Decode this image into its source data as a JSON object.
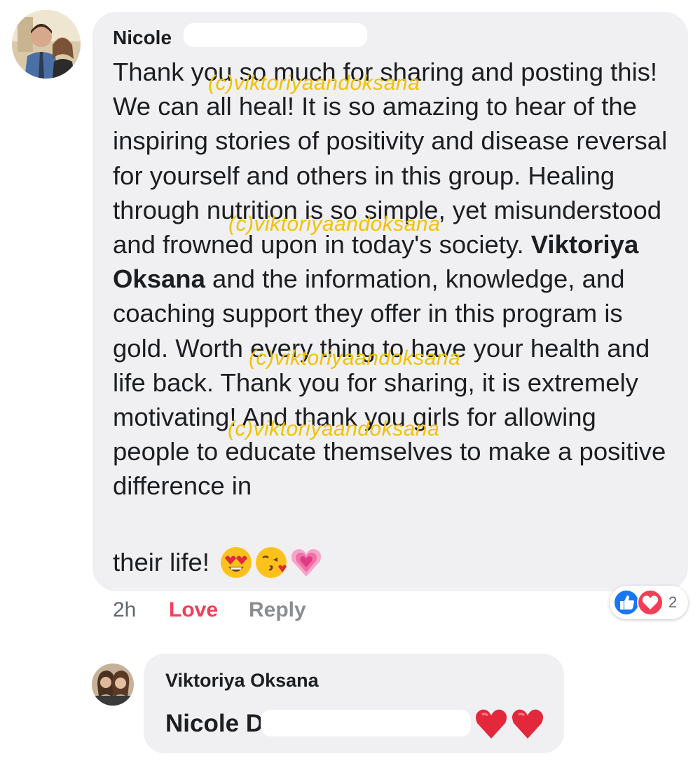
{
  "comment": {
    "author": "Nicole",
    "text_before_mention": "Thank you so much for sharing and posting this! We can all heal! It is so amazing to hear of the inspiring stories of positivity and disease reversal for yourself and others in this group. Healing through nutrition is so simple, yet misunderstood and frowned upon in today's society. ",
    "mention": "Viktoriya Oksana",
    "text_after_mention": " and the information, knowledge, and coaching support they offer in this program is gold. Worth every thing to have your health and life back. Thank you for sharing, it is extremely motivating! And thank you girls for allowing people to educate themselves to make a positive difference in",
    "last_line": "their life!",
    "emojis": [
      "heart-eyes-emoji",
      "kissing-heart-emoji",
      "growing-heart-emoji"
    ],
    "time": "2h",
    "love_label": "Love",
    "reply_label": "Reply",
    "reaction_count": "2",
    "reaction_icons": [
      "like-icon",
      "love-icon"
    ]
  },
  "reply": {
    "author": "Viktoriya Oksana",
    "mention": "Nicole D",
    "emojis": [
      "red-heart-emoji",
      "red-heart-emoji"
    ]
  },
  "watermark": "(c)viktoriyaandoksana",
  "colors": {
    "bubble": "#f0f0f3",
    "love": "#f33e58",
    "like_blue": "#1877f2",
    "watermark": "#f2c200",
    "muted": "#8b8d91"
  }
}
